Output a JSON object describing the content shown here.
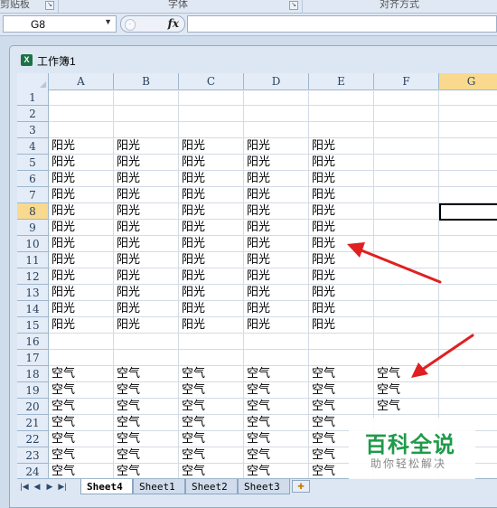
{
  "ribbon": {
    "groups": [
      {
        "label": "剪贴板"
      },
      {
        "label": "字体"
      },
      {
        "label": "对齐方式"
      }
    ]
  },
  "formula_bar": {
    "name_box": "G8",
    "fx": "fx",
    "formula": ""
  },
  "workbook": {
    "title": "工作簿1"
  },
  "grid": {
    "columns": [
      "A",
      "B",
      "C",
      "D",
      "E",
      "F",
      "G"
    ],
    "selected_column": "G",
    "rows": [
      "1",
      "2",
      "3",
      "4",
      "5",
      "6",
      "7",
      "8",
      "9",
      "10",
      "11",
      "12",
      "13",
      "14",
      "15",
      "16",
      "17",
      "18",
      "19",
      "20",
      "21",
      "22",
      "23",
      "24"
    ],
    "selected_row": "8",
    "active_cell": "G8",
    "cells": {
      "r4": [
        "阳光",
        "阳光",
        "阳光",
        "阳光",
        "阳光"
      ],
      "r5": [
        "阳光",
        "阳光",
        "阳光",
        "阳光",
        "阳光"
      ],
      "r6": [
        "阳光",
        "阳光",
        "阳光",
        "阳光",
        "阳光"
      ],
      "r7": [
        "阳光",
        "阳光",
        "阳光",
        "阳光",
        "阳光"
      ],
      "r8": [
        "阳光",
        "阳光",
        "阳光",
        "阳光",
        "阳光"
      ],
      "r9": [
        "阳光",
        "阳光",
        "阳光",
        "阳光",
        "阳光"
      ],
      "r10": [
        "阳光",
        "阳光",
        "阳光",
        "阳光",
        "阳光"
      ],
      "r11": [
        "阳光",
        "阳光",
        "阳光",
        "阳光",
        "阳光"
      ],
      "r12": [
        "阳光",
        "阳光",
        "阳光",
        "阳光",
        "阳光"
      ],
      "r13": [
        "阳光",
        "阳光",
        "阳光",
        "阳光",
        "阳光"
      ],
      "r14": [
        "阳光",
        "阳光",
        "阳光",
        "阳光",
        "阳光"
      ],
      "r15": [
        "阳光",
        "阳光",
        "阳光",
        "阳光",
        "阳光"
      ],
      "r18": [
        "空气",
        "空气",
        "空气",
        "空气",
        "空气",
        "空气"
      ],
      "r19": [
        "空气",
        "空气",
        "空气",
        "空气",
        "空气",
        "空气"
      ],
      "r20": [
        "空气",
        "空气",
        "空气",
        "空气",
        "空气",
        "空气"
      ],
      "r21": [
        "空气",
        "空气",
        "空气",
        "空气",
        "空气"
      ],
      "r22": [
        "空气",
        "空气",
        "空气",
        "空气",
        "空气"
      ],
      "r23": [
        "空气",
        "空气",
        "空气",
        "空气",
        "空气"
      ],
      "r24": [
        "空气",
        "空气",
        "空气",
        "空气",
        "空气"
      ]
    }
  },
  "sheet_tabs": {
    "tabs": [
      "Sheet4",
      "Sheet1",
      "Sheet2",
      "Sheet3"
    ],
    "active": "Sheet4"
  },
  "watermark": {
    "logo": "百科全说",
    "subtitle": "助你轻松解决"
  },
  "colors": {
    "selected_header": "#f9d98e",
    "arrow": "#e02020",
    "watermark_green": "#1f9a4a"
  }
}
